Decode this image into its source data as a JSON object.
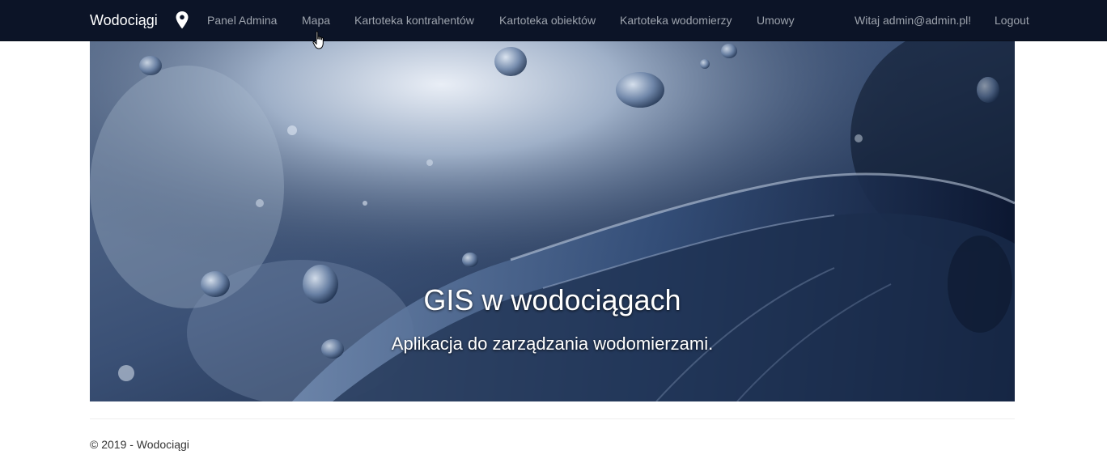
{
  "navbar": {
    "brand": "Wodociągi",
    "icon": "map-pin-icon",
    "links": [
      {
        "label": "Panel Admina"
      },
      {
        "label": "Mapa"
      },
      {
        "label": "Kartoteka kontrahentów"
      },
      {
        "label": "Kartoteka obiektów"
      },
      {
        "label": "Kartoteka wodomierzy"
      },
      {
        "label": "Umowy"
      }
    ],
    "greeting": "Witaj admin@admin.pl!",
    "logout": "Logout"
  },
  "hero": {
    "title": "GIS w wodociągach",
    "subtitle": "Aplikacja do zarządzania wodomierzami."
  },
  "footer": {
    "copyright": "© 2019 - Wodociągi"
  },
  "colors": {
    "navbar_bg": "#0c1427",
    "nav_link": "#9da3ad",
    "brand": "#ffffff"
  }
}
